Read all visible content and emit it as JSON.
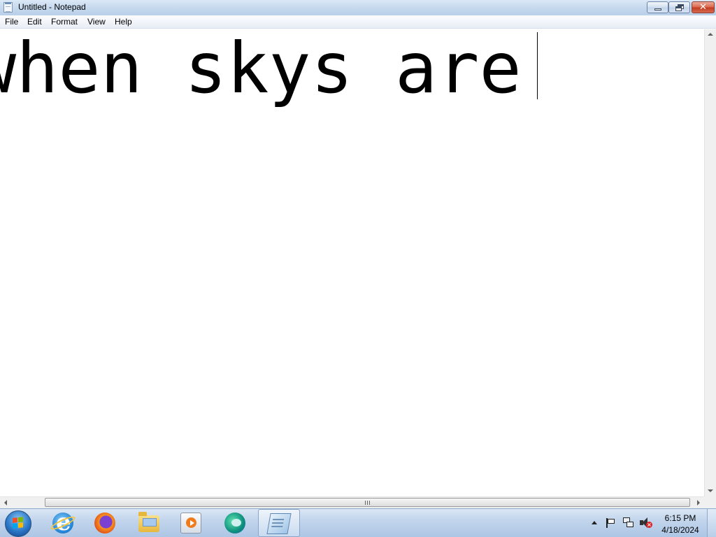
{
  "window": {
    "title": "Untitled - Notepad",
    "icon": "notepad-icon",
    "controls": [
      "minimize-icon",
      "restore-icon",
      "close-icon"
    ]
  },
  "menu": {
    "items": [
      "File",
      "Edit",
      "Format",
      "View",
      "Help"
    ]
  },
  "editor": {
    "text": "when skys are "
  },
  "taskbar": {
    "start_icon": "windows-start-icon",
    "apps": [
      {
        "name": "Internet Explorer",
        "icon": "internet-explorer-icon",
        "active": false
      },
      {
        "name": "Firefox",
        "icon": "firefox-icon",
        "active": false
      },
      {
        "name": "File Explorer",
        "icon": "folder-icon",
        "active": false
      },
      {
        "name": "Media Player",
        "icon": "media-player-icon",
        "active": false
      },
      {
        "name": "Edge",
        "icon": "edge-icon",
        "active": false
      },
      {
        "name": "Notepad",
        "icon": "notepad-icon",
        "active": true
      }
    ]
  },
  "tray": {
    "icons": [
      "show-hidden-icons-arrow",
      "action-center-flag-icon",
      "network-icon",
      "volume-muted-icon"
    ],
    "time": "6:15 PM",
    "date": "4/18/2024"
  },
  "colors": {
    "titlebar": "#c6d9ee",
    "close_button": "#c2391f",
    "taskbar": "#adc6e5"
  }
}
